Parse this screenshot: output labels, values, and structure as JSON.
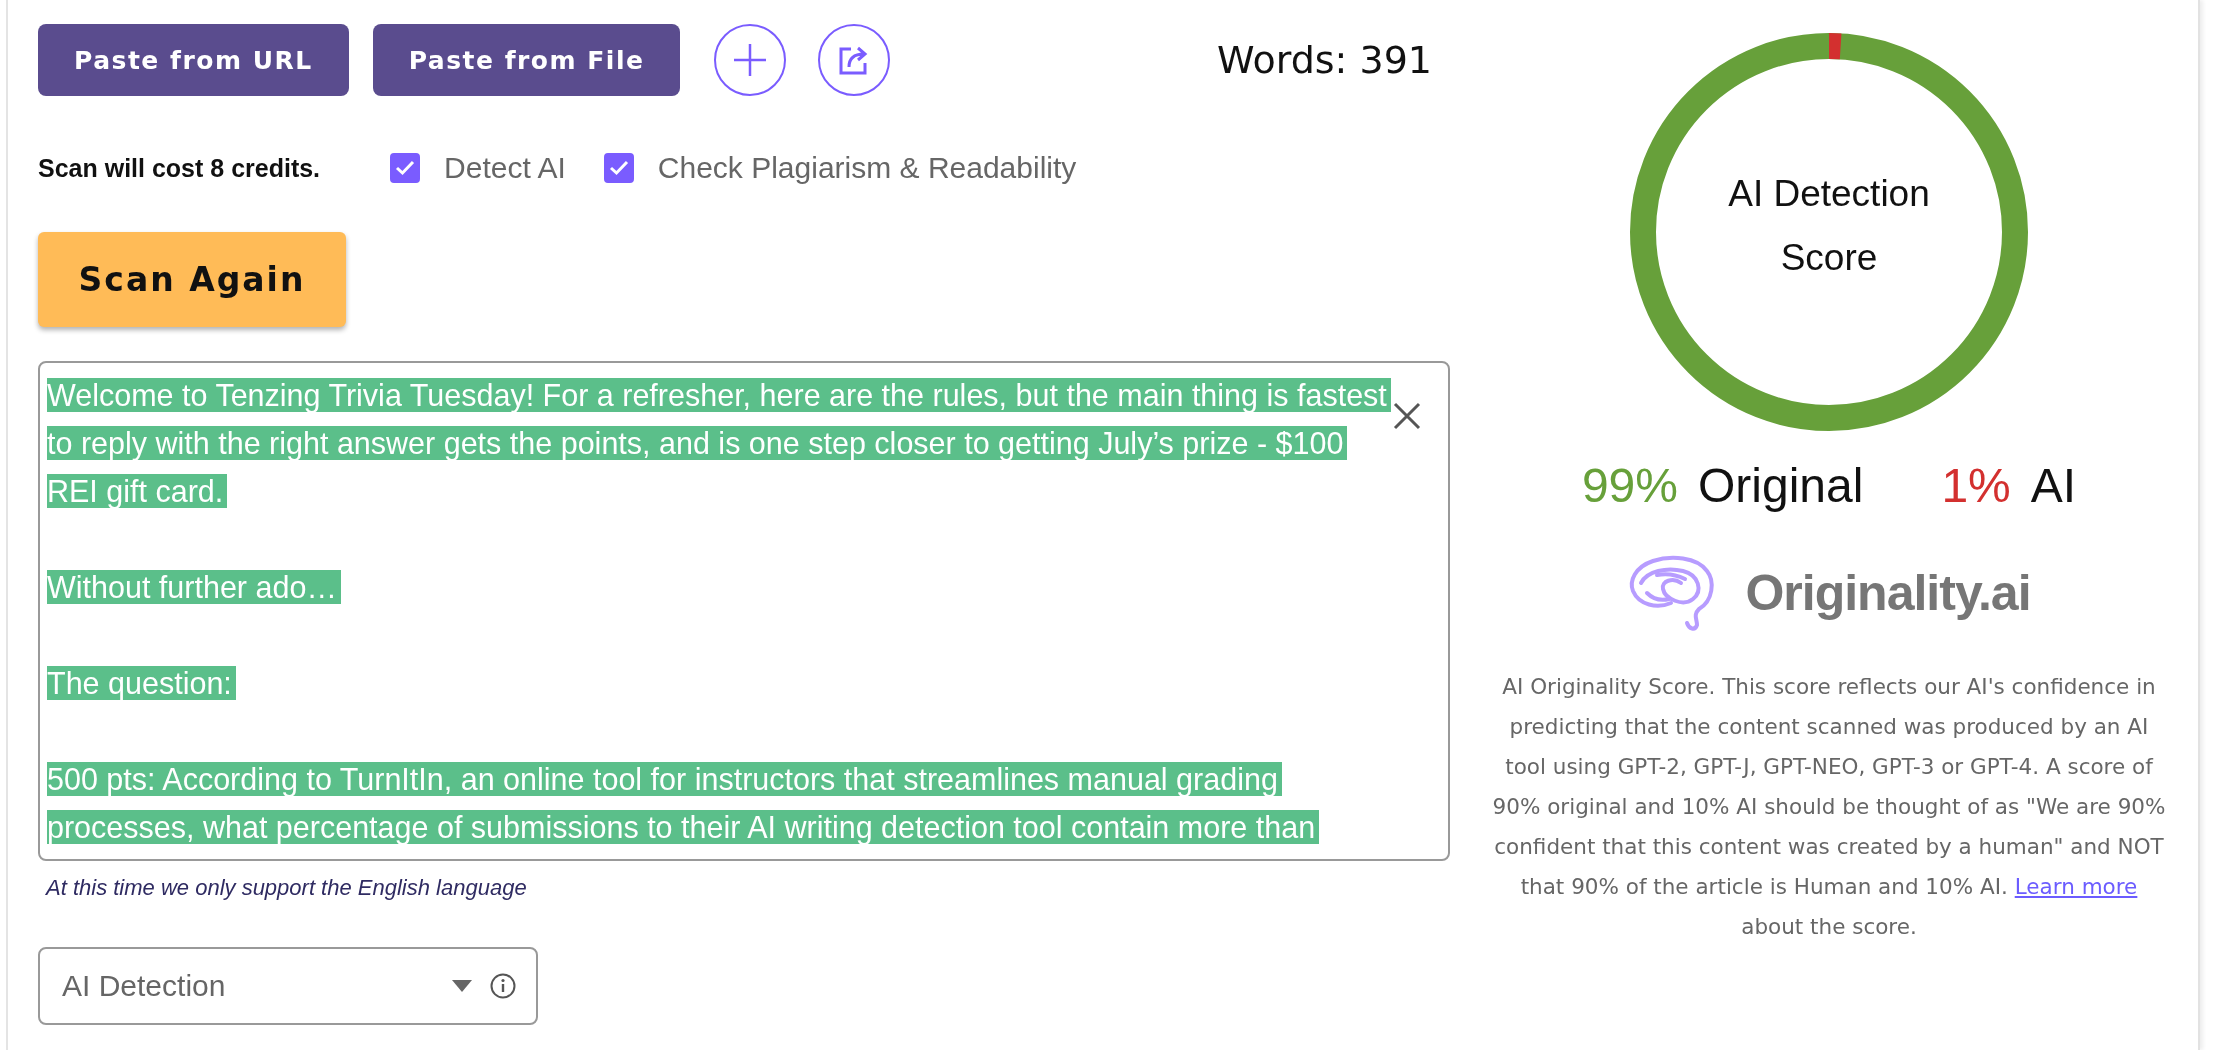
{
  "toolbar": {
    "buttons": [
      {
        "label": "Paste from URL"
      },
      {
        "label": "Paste from File"
      }
    ],
    "word_count": "Words: 391"
  },
  "scan_options": {
    "cost": "Scan will cost 8 credits.",
    "options": [
      {
        "label": "Detect AI",
        "checked": true
      },
      {
        "label": "Check Plagiarism & Readability",
        "checked": true
      }
    ],
    "scan_button": "Scan Again"
  },
  "editor": {
    "paragraphs": [
      {
        "text": "Welcome to Tenzing Trivia Tuesday! For a refresher, here are the rules, but the main thing is fastest to reply with the right answer gets the points, and is one step closer to getting July’s prize - $100 REI gift card."
      },
      {
        "text": "Without further ado…"
      },
      {
        "text": "The question:"
      },
      {
        "text": "500 pts: According to TurnItIn, an online tool for instructors that streamlines manual grading processes, what percentage of submissions to their AI writing detection tool contain more than"
      }
    ]
  },
  "language_note": "At this time we only support the English language",
  "mode_dropdown": {
    "value": "AI Detection"
  },
  "score_panel": {
    "gauge": {
      "title": "AI Detection Score",
      "level": 0.01
    },
    "scores": [
      {
        "percent": "99%",
        "name": "Original",
        "color": "#67a03a"
      },
      {
        "percent": "1%",
        "name": "AI",
        "color": "#d3302f"
      }
    ],
    "logo": "Originality.ai",
    "description": {
      "before": "AI Originality Score. This score reflects our AI's confidence in predicting that the content scanned was produced by an AI tool using GPT-2, GPT-J, GPT-NEO, GPT-3 or GPT-4. A score of 90% original and 10% AI should be thought of as \"We are 90% confident that this content was created by a human\" and NOT that 90% of the article is Human and 10% AI. ",
      "link": "Learn more",
      "after": " about the score."
    }
  }
}
